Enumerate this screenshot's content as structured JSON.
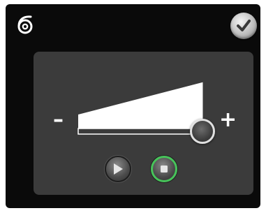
{
  "header": {
    "app_icon": "spiral-six-icon",
    "confirm_icon": "checkmark-icon"
  },
  "volume": {
    "minus_label": "–",
    "plus_label": "+",
    "level": 0.92
  },
  "controls": {
    "play_icon": "play-icon",
    "stop_icon": "stop-icon",
    "active": "stop"
  },
  "colors": {
    "background": "#0a0a0a",
    "panel": "#3b3b3b",
    "active_ring": "#47c35a",
    "wedge": "#ffffff"
  }
}
